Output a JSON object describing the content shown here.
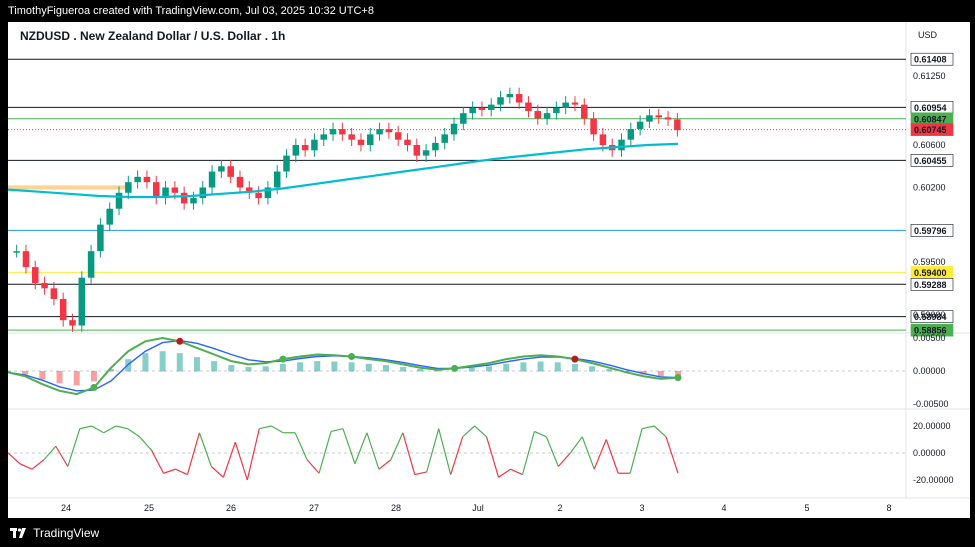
{
  "header": {
    "credit": "TimothyFigueroa created with TradingView.com, Jul 03, 2025 10:32 UTC+8"
  },
  "footer": {
    "brand": "TradingView"
  },
  "chart_data": {
    "type": "candlestick",
    "title": "NZDUSD . New Zealand Dollar / U.S. Dollar . 1h",
    "currency": "USD",
    "price_ticks": [
      "0.61250",
      "0.60600",
      "0.60200",
      "0.59500",
      "0.59000"
    ],
    "x_ticks": [
      "24",
      "25",
      "26",
      "27",
      "28",
      "Jul",
      "2",
      "3",
      "4",
      "5",
      "8"
    ],
    "horizontal_levels": [
      {
        "price": 0.61408,
        "label": "0.61408",
        "color": "#131722",
        "label_bg": "#ffffff"
      },
      {
        "price": 0.60954,
        "label": "0.60954",
        "color": "#131722",
        "label_bg": "#ffffff"
      },
      {
        "price": 0.60847,
        "label": "0.60847",
        "color": "#4caf50",
        "label_bg": "#4caf50"
      },
      {
        "price": 0.60745,
        "label": "0.60745",
        "color": "#f23645",
        "label_bg": "#f23645"
      },
      {
        "price": 0.60455,
        "label": "0.60455",
        "color": "#131722",
        "label_bg": "#ffffff"
      },
      {
        "price": 0.59796,
        "label": "0.59796",
        "color": "#2196f3",
        "label_bg": "#ffffff"
      },
      {
        "price": 0.594,
        "label": "0.59400",
        "color": "#ffeb3b",
        "label_bg": "#ffeb3b"
      },
      {
        "price": 0.59288,
        "label": "0.59288",
        "color": "#131722",
        "label_bg": "#ffffff"
      },
      {
        "price": 0.58984,
        "label": "0.58984",
        "color": "#131722",
        "label_bg": "#ffffff"
      },
      {
        "price": 0.58856,
        "label": "0.58856",
        "color": "#4caf50",
        "label_bg": "#4caf50"
      }
    ],
    "price_path": [
      0.596,
      0.5945,
      0.593,
      0.5925,
      0.5915,
      0.5895,
      0.589,
      0.5935,
      0.596,
      0.5985,
      0.6,
      0.6015,
      0.6025,
      0.603,
      0.6025,
      0.601,
      0.602,
      0.6015,
      0.6005,
      0.601,
      0.602,
      0.6035,
      0.604,
      0.603,
      0.602,
      0.6015,
      0.601,
      0.602,
      0.6035,
      0.605,
      0.606,
      0.6055,
      0.6065,
      0.607,
      0.6075,
      0.607,
      0.6065,
      0.606,
      0.607,
      0.6075,
      0.6072,
      0.6065,
      0.606,
      0.605,
      0.6055,
      0.6062,
      0.607,
      0.608,
      0.609,
      0.6095,
      0.6093,
      0.6098,
      0.6105,
      0.6108,
      0.61,
      0.6092,
      0.6085,
      0.609,
      0.6095,
      0.61,
      0.6098,
      0.6085,
      0.607,
      0.606,
      0.6055,
      0.6065,
      0.6075,
      0.6082,
      0.6088,
      0.6086,
      0.6084,
      0.6074
    ],
    "moving_average": [
      0.6018,
      0.6016,
      0.6014,
      0.6012,
      0.6011,
      0.6011,
      0.6012,
      0.6014,
      0.6016,
      0.6019,
      0.6023,
      0.6027,
      0.6031,
      0.6035,
      0.6039,
      0.6043,
      0.6047,
      0.605,
      0.6053,
      0.6056,
      0.6058,
      0.606,
      0.6061
    ],
    "highlight_zone": {
      "price_top": 0.6022,
      "price_bottom": 0.6018
    },
    "macd": {
      "ticks": [
        "0.00500",
        "0.00000",
        "-0.00500"
      ],
      "macd_line": [
        -0.0002,
        -0.0008,
        -0.002,
        -0.003,
        -0.0035,
        -0.0025,
        0.0005,
        0.003,
        0.0045,
        0.005,
        0.0045,
        0.0035,
        0.0025,
        0.0015,
        0.001,
        0.0012,
        0.0018,
        0.0022,
        0.0025,
        0.0024,
        0.0022,
        0.0018,
        0.0015,
        0.001,
        0.0005,
        0.0002,
        0.0004,
        0.0008,
        0.0012,
        0.0018,
        0.0022,
        0.0024,
        0.0022,
        0.0018,
        0.0012,
        0.0005,
        -0.0002,
        -0.0008,
        -0.0012,
        -0.001
      ],
      "signal_line": [
        -0.0002,
        -0.0006,
        -0.0014,
        -0.0024,
        -0.003,
        -0.0029,
        -0.0015,
        0.001,
        0.003,
        0.0043,
        0.0046,
        0.0042,
        0.0034,
        0.0025,
        0.0017,
        0.0014,
        0.0015,
        0.0019,
        0.0022,
        0.0023,
        0.0022,
        0.002,
        0.0017,
        0.0013,
        0.0008,
        0.0004,
        0.0004,
        0.0006,
        0.0009,
        0.0014,
        0.0018,
        0.0021,
        0.0021,
        0.0019,
        0.0015,
        0.0009,
        0.0002,
        -0.0004,
        -0.0009,
        -0.001
      ]
    },
    "rsi": {
      "ticks": [
        "20.00000",
        "0.00000",
        "-20.00000"
      ],
      "values": [
        0,
        -8,
        -12,
        -5,
        5,
        -10,
        18,
        20,
        15,
        20,
        18,
        12,
        2,
        -15,
        -12,
        -16,
        15,
        -10,
        -18,
        8,
        -20,
        18,
        20,
        15,
        15,
        -5,
        -15,
        16,
        18,
        -8,
        15,
        -12,
        -5,
        15,
        -16,
        -14,
        18,
        -16,
        12,
        20,
        12,
        -18,
        -12,
        -16,
        16,
        12,
        -10,
        0,
        12,
        -12,
        10,
        -15,
        -15,
        18,
        20,
        12,
        -15
      ]
    }
  }
}
